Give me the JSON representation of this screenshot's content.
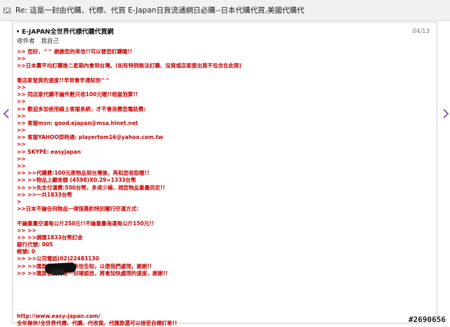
{
  "window": {
    "subject": "Re: 這是一封由代購、代標、代買 E-Japan日貨流通網日必購--日本代購代買,美國代購代"
  },
  "message": {
    "from": "E-JAPAN全世界代標代購代買網",
    "recipient_label": "收件者",
    "recipient_value": "我自己",
    "date": "04/13",
    "body_lines": [
      ">> 您好，^^ 謝謝您的來信!!可以替您訂購喔!!",
      ">>",
      ">>日本賣平均訂購後二星期內會到台灣。(如有特例無法訂購、沒貨或店家提出貨不包含在此限)",
      "",
      "看店家發貨的速度!!早到會早通知你^^",
      ">>",
      ">> 同店家代購不論件數只收100元喔!!相當划算!!",
      ">>",
      ">> 歡迎多加使用線上客服系統，才不會浪費您電話費:",
      ">>",
      ">> 客服msn: good.ejapan@msa.hinet.net",
      ">>",
      ">> 客服YAHOO即時通: playertom16@yahoo.com.tw",
      ">>",
      ">> SKYPE: easyjapan",
      ">>",
      ">>",
      ">> >>代購費:100元是物品到台灣後，再和您收取喔!!",
      ">> >>物品上顯金額 (4598)X0.29=1333台幣",
      ">> >>先支付運費:500台幣，多退少補，視您物品重量而定!!",
      ">> >>一共1833台幣",
      ">",
      ">>日本不論任何物品一律採簽約特別關行空運方式:",
      "",
      "不論重量空運每公斤250元!!不論重量海運每公斤150元!!",
      ">> >>",
      ">> >>請匯1833台幣訂金",
      "銀行代號: 005",
      "帳號: 0",
      ">> >>公司電話(02)22483130",
      ">> >>匯款後請來電或來信告知，以便我們處理，謝謝!!",
      ">> >>匯款後請再寄一封確認信，將會加快處理的速度，謝謝!!",
      "",
      "",
      "",
      "",
      "",
      "http://www.easy-japan.com/",
      "全年無休!全世界代標、代購、代收貨、代匯款還可以接受自標訂單!!"
    ]
  },
  "icons": {
    "mail": "mail-icon",
    "left": "chevron-left-icon",
    "right": "chevron-right-icon"
  },
  "colors": {
    "body_text": "#cc0000",
    "nav_arrow": "#8b5fb8"
  },
  "watermark": "#2690656"
}
